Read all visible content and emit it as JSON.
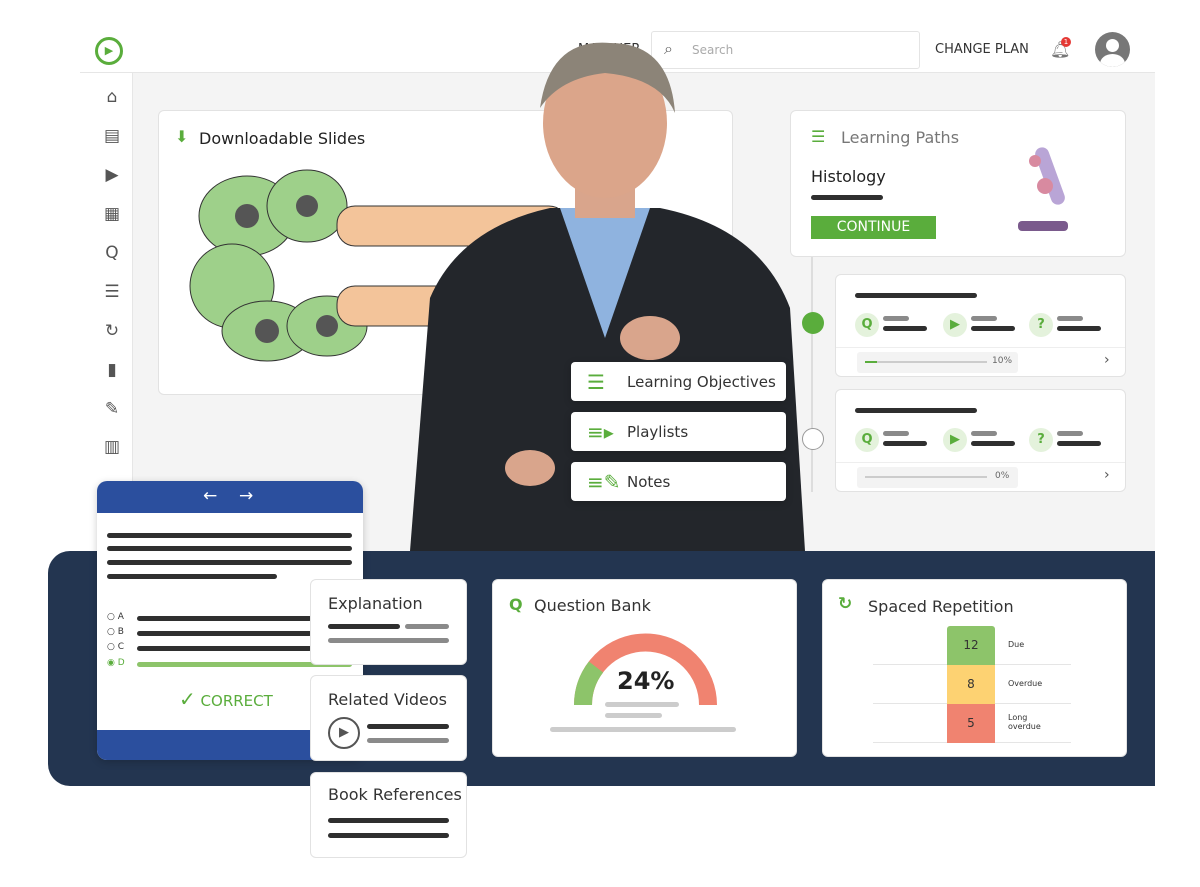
{
  "topbar": {
    "nav_label": "MATCHER",
    "search_placeholder": "Search",
    "change_plan": "CHANGE PLAN",
    "notification_count": "1"
  },
  "sidebar": {
    "icons": [
      "home-icon",
      "clipboard-icon",
      "video-icon",
      "library-icon",
      "qbank-icon",
      "learning-path-icon",
      "spaced-repetition-icon",
      "bookmark-icon",
      "notes-icon",
      "stats-icon"
    ]
  },
  "slides": {
    "title": "Downloadable Slides"
  },
  "learning_paths": {
    "title": "Learning Paths",
    "subject": "Histology",
    "continue_label": "CONTINUE",
    "items": [
      {
        "progress": "10%",
        "value": 10,
        "active": true
      },
      {
        "progress": "0%",
        "value": 0,
        "active": false
      }
    ]
  },
  "menu": {
    "items": [
      "Learning Objectives",
      "Playlists",
      "Notes"
    ]
  },
  "quiz": {
    "options": [
      "A",
      "B",
      "C",
      "D"
    ],
    "selected": "D",
    "result": "CORRECT"
  },
  "panels": {
    "explanation": "Explanation",
    "related_videos": "Related Videos",
    "book_references": "Book References"
  },
  "question_bank": {
    "title": "Question Bank",
    "percent": "24%",
    "value": 24
  },
  "spaced_repetition": {
    "title": "Spaced Repetition",
    "rows": [
      {
        "count": "12",
        "label": "Due",
        "color": "#8dc46a"
      },
      {
        "count": "8",
        "label": "Overdue",
        "color": "#fdd272"
      },
      {
        "count": "5",
        "label": "Long overdue",
        "color": "#f08370"
      }
    ]
  },
  "colors": {
    "accent": "#5aad3c",
    "navy": "#233550",
    "quiz_blue": "#2b4f9e"
  }
}
